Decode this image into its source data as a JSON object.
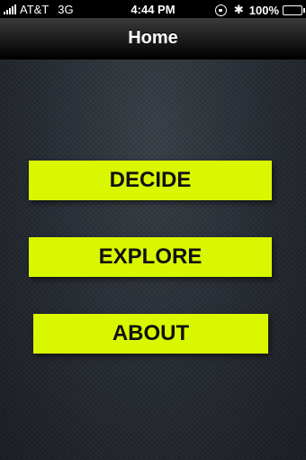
{
  "status_bar": {
    "carrier": "AT&T",
    "network": "3G",
    "time": "4:44 PM",
    "battery_percent": "100%",
    "icons": [
      "signal-icon",
      "rotation-lock-icon",
      "bluetooth-icon",
      "battery-icon"
    ]
  },
  "nav": {
    "title": "Home"
  },
  "menu": {
    "decide_label": "DECIDE",
    "explore_label": "EXPLORE",
    "about_label": "ABOUT"
  },
  "colors": {
    "button_bg": "#d9f700",
    "button_text": "#111111",
    "background": "#1f232b",
    "nav_bar": "#1a1a1a"
  }
}
